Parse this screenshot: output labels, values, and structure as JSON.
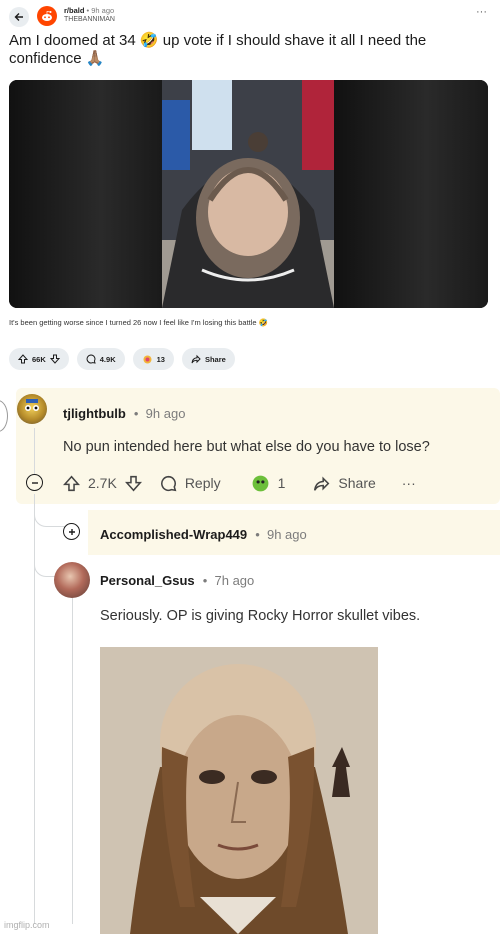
{
  "post": {
    "subreddit": "r/bald",
    "dot": "•",
    "age": "9h ago",
    "author": "THEBANNIMAN",
    "more": "···",
    "title": "Am I doomed at 34 🤣 up vote if I should shave it all I need the confidence 🙏🏽",
    "caption": "It's been getting worse since I turned 26 now I feel like I'm losing this battle 🤣",
    "upvotes": "66K",
    "comments": "4.9K",
    "awards": "13",
    "share": "Share"
  },
  "comments": [
    {
      "author": "tjlightbulb",
      "age": "9h ago",
      "body": "No pun intended here but what else do you have to lose?",
      "upvotes": "2.7K",
      "reply": "Reply",
      "awards": "1",
      "share": "Share",
      "more": "···"
    },
    {
      "author": "Accomplished-Wrap449",
      "age": "9h ago"
    },
    {
      "author": "Personal_Gsus",
      "age": "7h ago",
      "body": "Seriously. OP is giving Rocky Horror skullet vibes."
    }
  ],
  "watermark": "imgflip.com",
  "colors": {
    "accent": "#ff4500",
    "highlight": "#fcf8e8",
    "pill": "#e9edf0"
  }
}
